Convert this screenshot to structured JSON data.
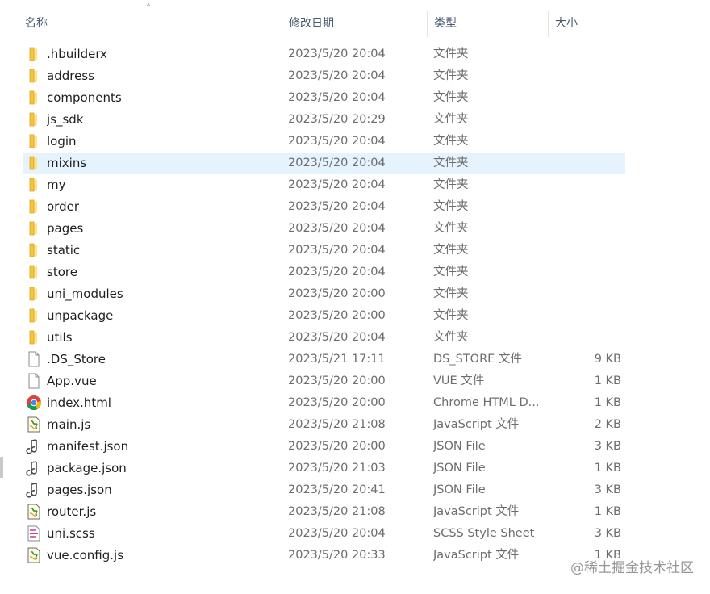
{
  "header": {
    "name": "名称",
    "date": "修改日期",
    "type": "类型",
    "size": "大小"
  },
  "files": [
    {
      "name": ".hbuilderx",
      "date": "2023/5/20 20:04",
      "type": "文件夹",
      "size": "",
      "icon": "folder-icon"
    },
    {
      "name": "address",
      "date": "2023/5/20 20:04",
      "type": "文件夹",
      "size": "",
      "icon": "folder-icon"
    },
    {
      "name": "components",
      "date": "2023/5/20 20:04",
      "type": "文件夹",
      "size": "",
      "icon": "folder-icon"
    },
    {
      "name": "js_sdk",
      "date": "2023/5/20 20:29",
      "type": "文件夹",
      "size": "",
      "icon": "folder-icon"
    },
    {
      "name": "login",
      "date": "2023/5/20 20:04",
      "type": "文件夹",
      "size": "",
      "icon": "folder-icon"
    },
    {
      "name": "mixins",
      "date": "2023/5/20 20:04",
      "type": "文件夹",
      "size": "",
      "icon": "folder-icon",
      "selected": true
    },
    {
      "name": "my",
      "date": "2023/5/20 20:04",
      "type": "文件夹",
      "size": "",
      "icon": "folder-icon"
    },
    {
      "name": "order",
      "date": "2023/5/20 20:04",
      "type": "文件夹",
      "size": "",
      "icon": "folder-icon"
    },
    {
      "name": "pages",
      "date": "2023/5/20 20:04",
      "type": "文件夹",
      "size": "",
      "icon": "folder-icon"
    },
    {
      "name": "static",
      "date": "2023/5/20 20:04",
      "type": "文件夹",
      "size": "",
      "icon": "folder-icon"
    },
    {
      "name": "store",
      "date": "2023/5/20 20:04",
      "type": "文件夹",
      "size": "",
      "icon": "folder-icon"
    },
    {
      "name": "uni_modules",
      "date": "2023/5/20 20:00",
      "type": "文件夹",
      "size": "",
      "icon": "folder-icon"
    },
    {
      "name": "unpackage",
      "date": "2023/5/20 20:00",
      "type": "文件夹",
      "size": "",
      "icon": "folder-icon"
    },
    {
      "name": "utils",
      "date": "2023/5/20 20:04",
      "type": "文件夹",
      "size": "",
      "icon": "folder-icon"
    },
    {
      "name": ".DS_Store",
      "date": "2023/5/21 17:11",
      "type": "DS_STORE 文件",
      "size": "9 KB",
      "icon": "blank-file-icon"
    },
    {
      "name": "App.vue",
      "date": "2023/5/20 20:00",
      "type": "VUE 文件",
      "size": "1 KB",
      "icon": "blank-file-icon"
    },
    {
      "name": "index.html",
      "date": "2023/5/20 20:00",
      "type": "Chrome HTML D...",
      "size": "1 KB",
      "icon": "chrome-icon"
    },
    {
      "name": "main.js",
      "date": "2023/5/20 21:08",
      "type": "JavaScript 文件",
      "size": "2 KB",
      "icon": "script-file-icon"
    },
    {
      "name": "manifest.json",
      "date": "2023/5/20 20:00",
      "type": "JSON File",
      "size": "3 KB",
      "icon": "json-file-icon"
    },
    {
      "name": "package.json",
      "date": "2023/5/20 21:03",
      "type": "JSON File",
      "size": "1 KB",
      "icon": "json-file-icon"
    },
    {
      "name": "pages.json",
      "date": "2023/5/20 20:41",
      "type": "JSON File",
      "size": "3 KB",
      "icon": "json-file-icon"
    },
    {
      "name": "router.js",
      "date": "2023/5/20 21:08",
      "type": "JavaScript 文件",
      "size": "1 KB",
      "icon": "script-file-icon"
    },
    {
      "name": "uni.scss",
      "date": "2023/5/20 20:04",
      "type": "SCSS Style Sheet",
      "size": "3 KB",
      "icon": "scss-file-icon"
    },
    {
      "name": "vue.config.js",
      "date": "2023/5/20 20:33",
      "type": "JavaScript 文件",
      "size": "1 KB",
      "icon": "script-file-icon"
    }
  ],
  "watermark": "@稀土掘金技术社区",
  "colors": {
    "selection": "#e5f3ff",
    "folder": "#f5c542",
    "header_text": "#4a5870"
  }
}
